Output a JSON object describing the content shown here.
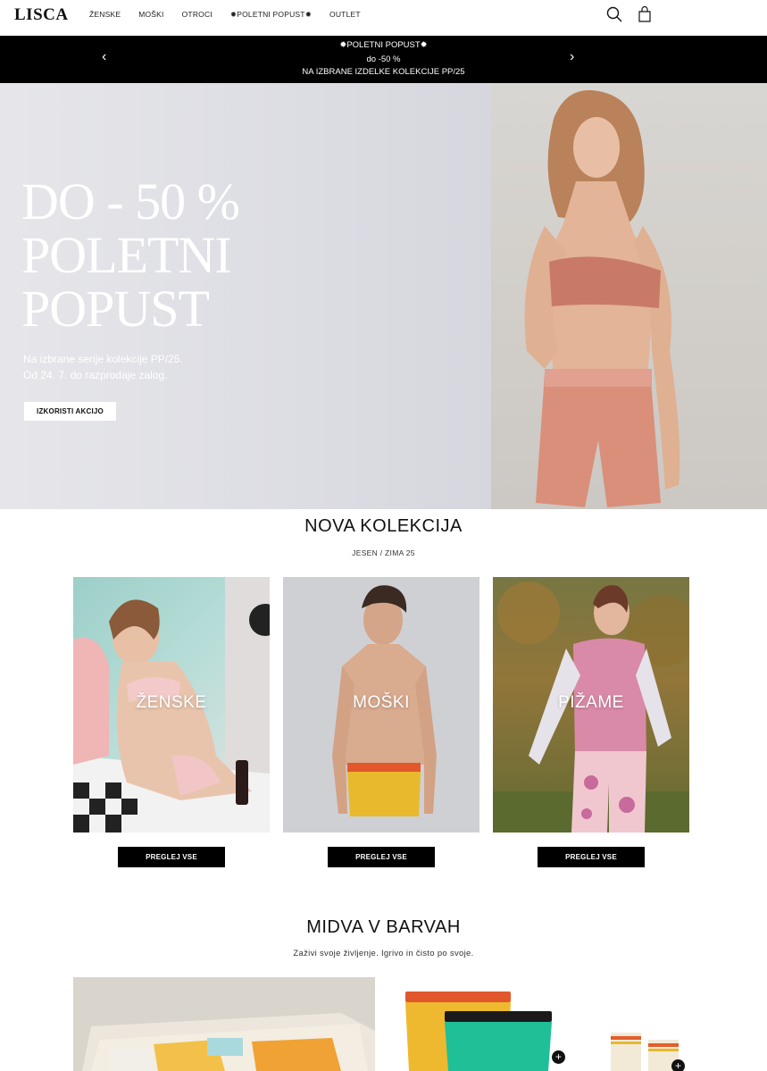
{
  "header": {
    "logo": "LISCA",
    "nav": [
      "ŽENSKE",
      "MOŠKI",
      "OTROCI",
      "✹POLETNI POPUST✹",
      "OUTLET"
    ],
    "icons": [
      "search-icon",
      "cart-icon"
    ]
  },
  "promo_bar": {
    "line1": "✹POLETNI POPUST✹",
    "line2": "do -50 %",
    "line3": "NA IZBRANE IZDELKE KOLEKCIJE PP/25",
    "prev": "‹",
    "next": "›"
  },
  "hero": {
    "title_line1": "DO - 50 %",
    "title_line2": "POLETNI",
    "title_line3": "POPUST",
    "sub_line1": "Na izbrane serije kolekcije PP/25.",
    "sub_line2": "Od 24. 7. do razprodaje zalog.",
    "cta": "IZKORISTI AKCIJO"
  },
  "new_collection": {
    "title": "NOVA KOLEKCIJA",
    "subtitle": "JESEN / ZIMA 25",
    "cards": [
      {
        "label": "ŽENSKE",
        "button": "PREGLEJ VSE"
      },
      {
        "label": "MOŠKI",
        "button": "PREGLEJ VSE"
      },
      {
        "label": "PIŽAME",
        "button": "PREGLEJ VSE"
      }
    ]
  },
  "colors_section": {
    "title": "MIDVA V BARVAH",
    "subtitle": "Zaživi svoje življenje. Igrivo in čisto po svoje."
  },
  "colors": {
    "black": "#000000",
    "white": "#ffffff"
  }
}
